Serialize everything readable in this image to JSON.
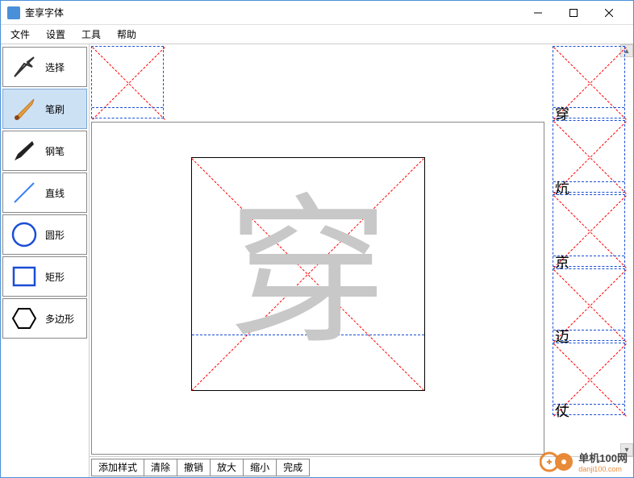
{
  "titlebar": {
    "title": "奎享字体"
  },
  "menu": {
    "file": "文件",
    "settings": "设置",
    "tools": "工具",
    "help": "帮助"
  },
  "tools": {
    "select": "选择",
    "brush": "笔刷",
    "pen": "钢笔",
    "line": "直线",
    "circle": "圆形",
    "rect": "矩形",
    "polygon": "多边形"
  },
  "canvas": {
    "current_char": "穿"
  },
  "side_chars": [
    "穿",
    "炕",
    "京",
    "迈",
    "仗"
  ],
  "bottom": {
    "add_style": "添加样式",
    "clear": "清除",
    "undo": "撤销",
    "zoom_in": "放大",
    "zoom_out": "缩小",
    "done": "完成"
  },
  "watermark": {
    "brand": "单机100网",
    "url": "danji100.com"
  }
}
